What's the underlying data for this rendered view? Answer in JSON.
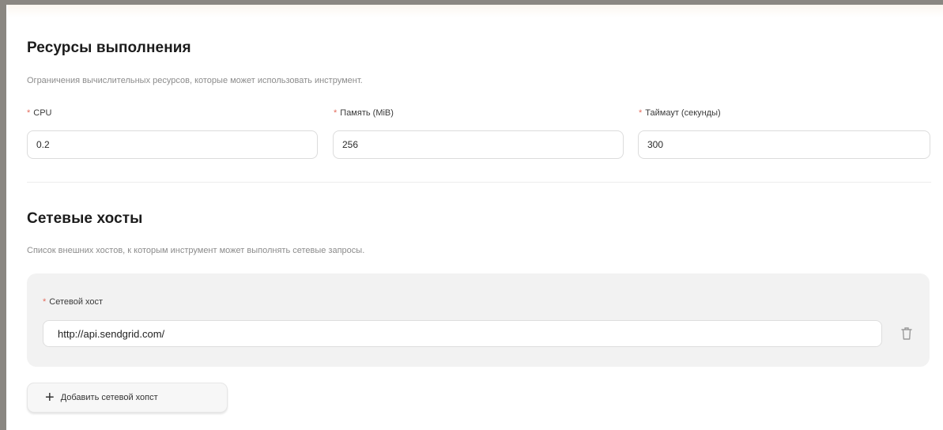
{
  "resources": {
    "title": "Ресурсы выполнения",
    "description": "Ограничения вычислительных ресурсов, которые может использовать инструмент.",
    "required_mark": "*",
    "cpu": {
      "label": "CPU",
      "value": "0.2"
    },
    "memory": {
      "label": "Память (MiB)",
      "value": "256"
    },
    "timeout": {
      "label": "Таймаут (секунды)",
      "value": "300"
    }
  },
  "network": {
    "title": "Сетевые хосты",
    "description": "Список внешних хостов, к которым инструмент может выполнять сетевые запросы.",
    "host_label": "Сетевой хост",
    "host_value": "http://api.sendgrid.com/",
    "add_label": "Добавить сетевой хопст"
  },
  "icons": {
    "delete": "trash-icon",
    "add": "plus-icon"
  },
  "colors": {
    "required": "#e36b5c",
    "card_bg": "#f2f2f2"
  }
}
